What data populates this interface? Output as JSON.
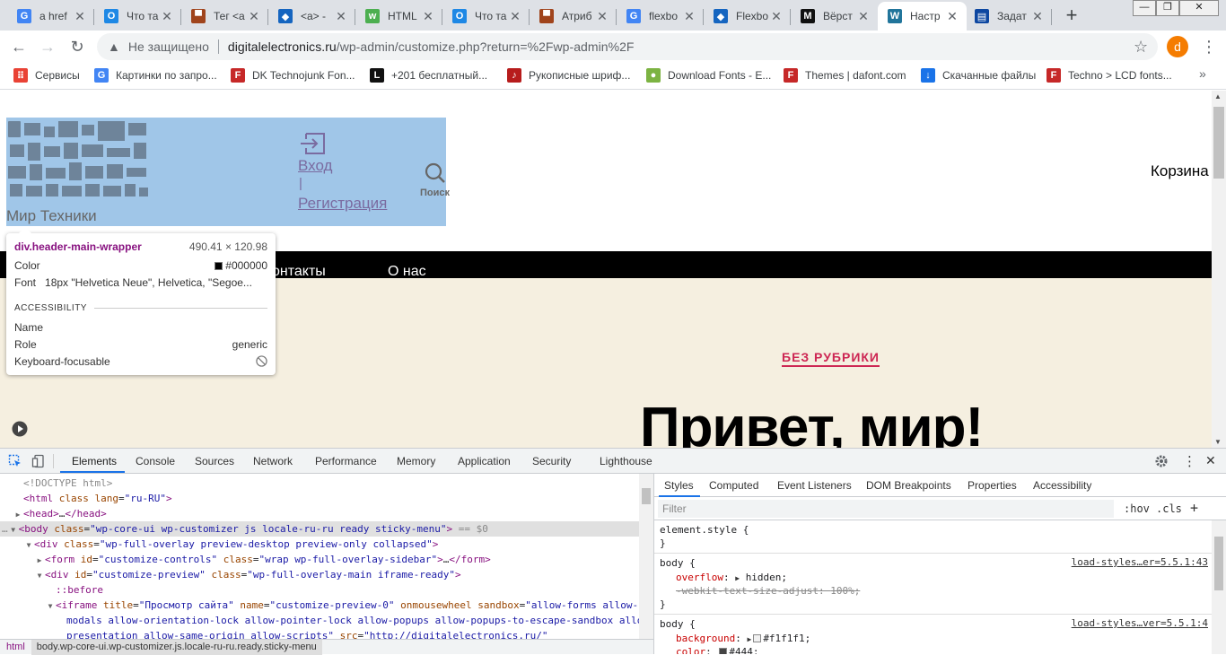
{
  "tabs": [
    {
      "title": "a href",
      "icon": "google-icon",
      "color": "#4285f4",
      "glyph": "G"
    },
    {
      "title": "Что та",
      "icon": "circle-o-icon",
      "color": "#1e88e5",
      "glyph": "O"
    },
    {
      "title": "Тег <a",
      "icon": "htmlbook-icon",
      "color": "#a0441c",
      "glyph": "▀"
    },
    {
      "title": "<a> - ",
      "icon": "mdn-icon",
      "color": "#1565c0",
      "glyph": "◆"
    },
    {
      "title": "HTML",
      "icon": "w3schools-icon",
      "color": "#4caf50",
      "glyph": "w"
    },
    {
      "title": "Что та",
      "icon": "circle-o-icon",
      "color": "#1e88e5",
      "glyph": "O"
    },
    {
      "title": "Атриб",
      "icon": "htmlbook-icon",
      "color": "#a0441c",
      "glyph": "▀"
    },
    {
      "title": "flexbo",
      "icon": "google-icon",
      "color": "#4285f4",
      "glyph": "G"
    },
    {
      "title": "Flexbo",
      "icon": "mdn-icon",
      "color": "#1565c0",
      "glyph": "◆"
    },
    {
      "title": "Вёрст",
      "icon": "medium-icon",
      "color": "#111111",
      "glyph": "M"
    },
    {
      "title": "Настр",
      "icon": "wordpress-icon",
      "color": "#21759b",
      "glyph": "W",
      "active": true
    },
    {
      "title": "Задат",
      "icon": "stackoverflow-icon",
      "color": "#0d47a1",
      "glyph": "▤"
    }
  ],
  "address": {
    "security": "Не защищено",
    "url_host": "digitalelectronics.ru",
    "url_path": "/wp-admin/customize.php?return=%2Fwp-admin%2F",
    "profile_letter": "d"
  },
  "bookmarks": [
    {
      "label": "Сервисы",
      "icon": "apps-grid-icon",
      "color": "#e94235",
      "glyph": "⠿"
    },
    {
      "label": "Картинки по запро...",
      "icon": "google-icon",
      "color": "#4285f4",
      "glyph": "G"
    },
    {
      "label": "DK Technojunk Fon...",
      "icon": "dafont-icon",
      "color": "#c62828",
      "glyph": "F"
    },
    {
      "label": "+201 бесплатный...",
      "icon": "l-icon",
      "color": "#111111",
      "glyph": "L"
    },
    {
      "label": "Рукописные шриф...",
      "icon": "guitar-icon",
      "color": "#b71c1c",
      "glyph": "♪"
    },
    {
      "label": "Download Fonts - E...",
      "icon": "leaf-icon",
      "color": "#7cb342",
      "glyph": "●"
    },
    {
      "label": "Themes | dafont.com",
      "icon": "dafont-icon",
      "color": "#c62828",
      "glyph": "F"
    },
    {
      "label": "Скачанные файлы",
      "icon": "download-icon",
      "color": "#1a73e8",
      "glyph": "↓"
    },
    {
      "label": "Techno > LCD fonts...",
      "icon": "dafont-icon",
      "color": "#c62828",
      "glyph": "F"
    }
  ],
  "site": {
    "logo_text": "Мир Техники",
    "login": "Вход",
    "separator": "|",
    "register": "Регистрация",
    "search_label": "Поиск",
    "cart": "Корзина",
    "nav": [
      "онтакты",
      "О нас"
    ],
    "category": "БЕЗ РУБРИКИ",
    "headline": "Привет, мир!"
  },
  "tooltip": {
    "element": "div.header-main-wrapper",
    "dimensions": "490.41 × 120.98",
    "color_label": "Color",
    "color_value": "#000000",
    "font_label": "Font",
    "font_value": "18px \"Helvetica Neue\", Helvetica, \"Segoe...",
    "section": "ACCESSIBILITY",
    "name_label": "Name",
    "role_label": "Role",
    "role_value": "generic",
    "focus_label": "Keyboard-focusable"
  },
  "devtools": {
    "tabs": [
      "Elements",
      "Console",
      "Sources",
      "Network",
      "Performance",
      "Memory",
      "Application",
      "Security",
      "Lighthouse"
    ],
    "active_tab": "Elements",
    "code_lines": [
      {
        "indent": 0,
        "tri": "",
        "html": "<span class=\"c-gray\">&lt;!DOCTYPE html&gt;</span>"
      },
      {
        "indent": 0,
        "tri": "",
        "html": "<span class=\"c-tag\">&lt;html</span> <span class=\"c-attr\">class</span> <span class=\"c-attr\">lang</span>=<span class=\"c-val\">\"ru-RU\"</span><span class=\"c-tag\">&gt;</span>"
      },
      {
        "indent": 0,
        "tri": "▶",
        "html": "<span class=\"c-tag\">&lt;head&gt;</span><span class=\"c-txt\">…</span><span class=\"c-tag\">&lt;/head&gt;</span>"
      },
      {
        "indent": 0,
        "tri": "▼",
        "sel": true,
        "html": "<span class=\"c-tag\">&lt;body</span> <span class=\"c-attr\">class</span>=<span class=\"c-val\">\"wp-core-ui wp-customizer js locale-ru-ru ready sticky-menu\"</span><span class=\"c-tag\">&gt;</span> <span class=\"c-gray\">== $0</span>"
      },
      {
        "indent": 1,
        "tri": "▼",
        "html": "<span class=\"c-tag\">&lt;div</span> <span class=\"c-attr\">class</span>=<span class=\"c-val\">\"wp-full-overlay preview-desktop preview-only collapsed\"</span><span class=\"c-tag\">&gt;</span>"
      },
      {
        "indent": 2,
        "tri": "▶",
        "html": "<span class=\"c-tag\">&lt;form</span> <span class=\"c-attr\">id</span>=<span class=\"c-val\">\"customize-controls\"</span> <span class=\"c-attr\">class</span>=<span class=\"c-val\">\"wrap wp-full-overlay-sidebar\"</span><span class=\"c-tag\">&gt;</span><span class=\"c-txt\">…</span><span class=\"c-tag\">&lt;/form&gt;</span>"
      },
      {
        "indent": 2,
        "tri": "▼",
        "html": "<span class=\"c-tag\">&lt;div</span> <span class=\"c-attr\">id</span>=<span class=\"c-val\">\"customize-preview\"</span> <span class=\"c-attr\">class</span>=<span class=\"c-val\">\"wp-full-overlay-main iframe-ready\"</span><span class=\"c-tag\">&gt;</span>"
      },
      {
        "indent": 3,
        "tri": "",
        "html": "<span class=\"c-tag\">::before</span>"
      },
      {
        "indent": 3,
        "tri": "▼",
        "html": "<span class=\"c-tag\">&lt;iframe</span> <span class=\"c-attr\">title</span>=<span class=\"c-val\">\"Просмотр сайта\"</span> <span class=\"c-attr\">name</span>=<span class=\"c-val\">\"customize-preview-0\"</span> <span class=\"c-attr\">onmousewheel</span> <span class=\"c-attr\">sandbox</span>=<span class=\"c-val\">\"allow-forms allow-</span>"
      },
      {
        "indent": 4,
        "tri": "",
        "html": "<span class=\"c-val\">modals allow-orientation-lock allow-pointer-lock allow-popups allow-popups-to-escape-sandbox allow-</span>"
      },
      {
        "indent": 4,
        "tri": "",
        "html": "<span class=\"c-val\">presentation allow-same-origin allow-scripts\"</span> <span class=\"c-attr\">src</span>=<span class=\"c-val\">\"http://digitalelectronics.ru/\"</span>"
      }
    ],
    "breadcrumb": [
      "html",
      "body.wp-core-ui.wp-customizer.js.locale-ru-ru.ready.sticky-menu"
    ],
    "side_tabs": [
      "Styles",
      "Computed",
      "Event Listeners",
      "DOM Breakpoints",
      "Properties",
      "Accessibility"
    ],
    "filter_placeholder": "Filter",
    "hov": ":hov",
    "cls": ".cls",
    "rules": {
      "element_style": "element.style {",
      "close": "}",
      "body1_selector": "body {",
      "body1_src": "load-styles…er=5.5.1:43",
      "overflow_prop": "overflow",
      "overflow_val": "hidden;",
      "webkit_prop": "-webkit-text-size-adjust",
      "webkit_val": "100%;",
      "body2_selector": "body {",
      "body2_src": "load-styles…ver=5.5.1:4",
      "bg_prop": "background",
      "bg_val": "#f1f1f1;",
      "color_prop": "color",
      "color_val": "#444;"
    }
  }
}
